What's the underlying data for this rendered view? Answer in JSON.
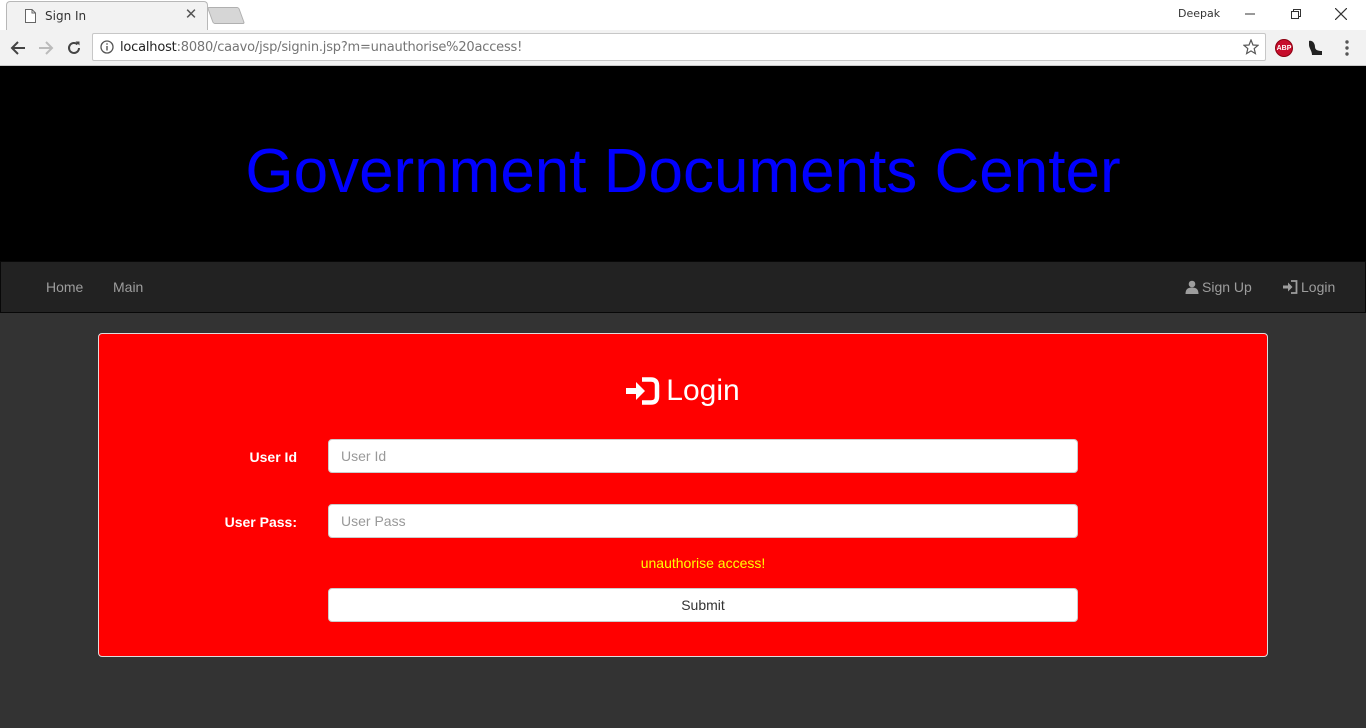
{
  "browser": {
    "tab_title": "Sign In",
    "profile_name": "Deepak",
    "url_host": "localhost",
    "url_rest": ":8080/caavo/jsp/signin.jsp?m=unauthorise%20access!",
    "extensions": [
      "adblock-plus-icon",
      "extension-icon"
    ],
    "abp_text": "ABP"
  },
  "site": {
    "title": "Government Documents Center",
    "title_color": "#0000ff",
    "header_bg": "#000000"
  },
  "nav": {
    "left": [
      "Home",
      "Main"
    ],
    "signup_label": "Sign Up",
    "login_label": "Login"
  },
  "login_form": {
    "heading": "Login",
    "panel_color": "#ff0000",
    "user_id_label": "User Id",
    "user_id_placeholder": "User Id",
    "user_id_value": "",
    "user_pass_label": "User Pass:",
    "user_pass_placeholder": "User Pass",
    "user_pass_value": "",
    "error_message": "unauthorise access!",
    "error_color": "#ffff00",
    "submit_label": "Submit"
  }
}
